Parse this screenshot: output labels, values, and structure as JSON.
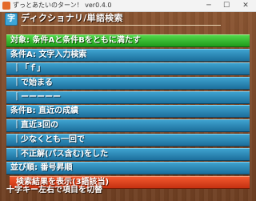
{
  "window": {
    "title": "ずっとあたいのターン！ ver0.4.0",
    "min": "─",
    "max": "☐",
    "close": "✕"
  },
  "header": {
    "icon_glyph": "字",
    "title": "ディクショナリ/単語検索"
  },
  "rows": [
    {
      "text": "対象: 条件Aと条件Bをともに満たす",
      "state": "selected"
    },
    {
      "text": "条件A: 文字入力検索",
      "state": "normal"
    },
    {
      "text": "｜「ｆ」",
      "state": "normal"
    },
    {
      "text": "｜で始まる",
      "state": "normal"
    },
    {
      "text": "｜ーーーーー",
      "state": "normal"
    },
    {
      "text": "条件B: 直近の成績",
      "state": "normal"
    },
    {
      "text": "｜直近3回の",
      "state": "normal"
    },
    {
      "text": "｜少なくとも一回で",
      "state": "normal"
    },
    {
      "text": "｜不正解(パス含む)をした",
      "state": "normal"
    },
    {
      "text": "並び順: 番号昇順",
      "state": "normal"
    },
    {
      "text": "検索結果を表示(3語該当)",
      "state": "action"
    }
  ],
  "footer": {
    "hint": "十字キー左右で項目を切替"
  },
  "colors": {
    "row_blue": "#2a89ba",
    "row_selected_green": "#35bf2f",
    "row_action_red": "#e2461e",
    "background_wood": "#7a4a2a"
  }
}
